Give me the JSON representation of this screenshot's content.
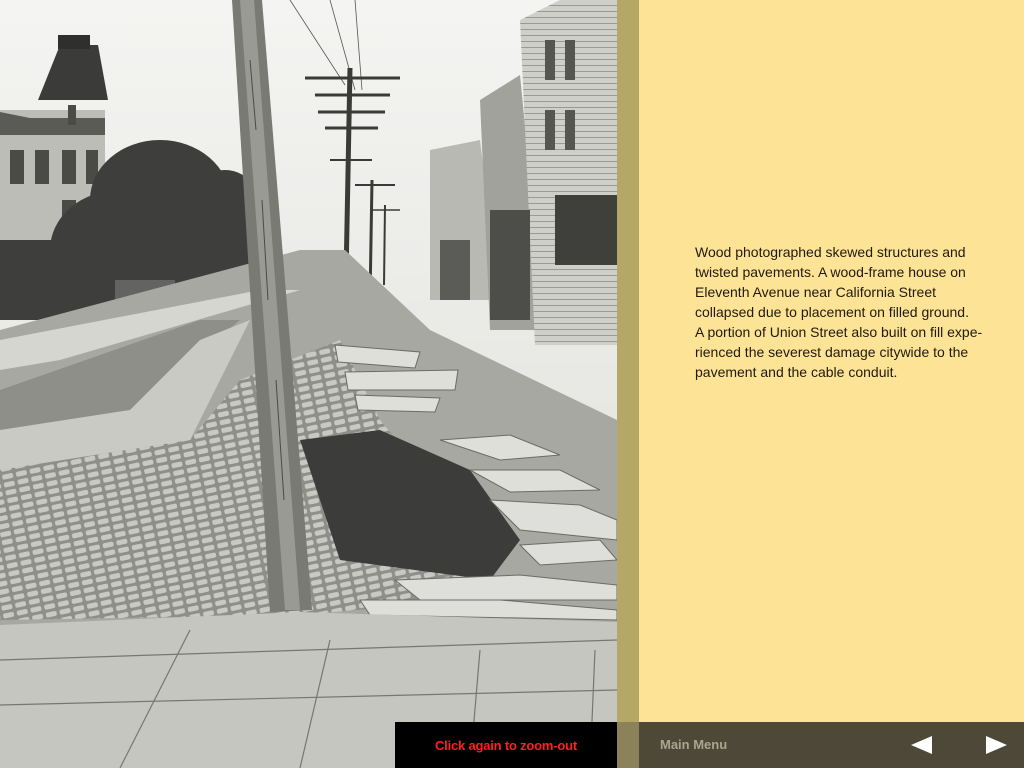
{
  "photo": {
    "icon": "earthquake-damage-photo"
  },
  "caption": {
    "text": "Wood photographed skewed structures and\ntwisted pavements. A wood-frame house on\nEleventh Avenue near California Street\ncollapsed due to placement on filled ground.\nA portion of Union Street also built on fill expe-\nrienced the severest damage citywide to the\npavement and the cable conduit."
  },
  "zoom": {
    "label": "Click again to zoom-out"
  },
  "nav": {
    "main_menu_label": "Main Menu",
    "prev_icon": "left-arrow-icon",
    "next_icon": "right-arrow-icon"
  },
  "colors": {
    "caption_bg": "#fde396",
    "divider": "#b5a866",
    "nav_bar_bg": "#4e4838",
    "zoom_bar_bg": "#000000",
    "zoom_label": "#ff1f1f",
    "main_menu_label": "#a9a58f",
    "arrow": "#ffffff"
  }
}
